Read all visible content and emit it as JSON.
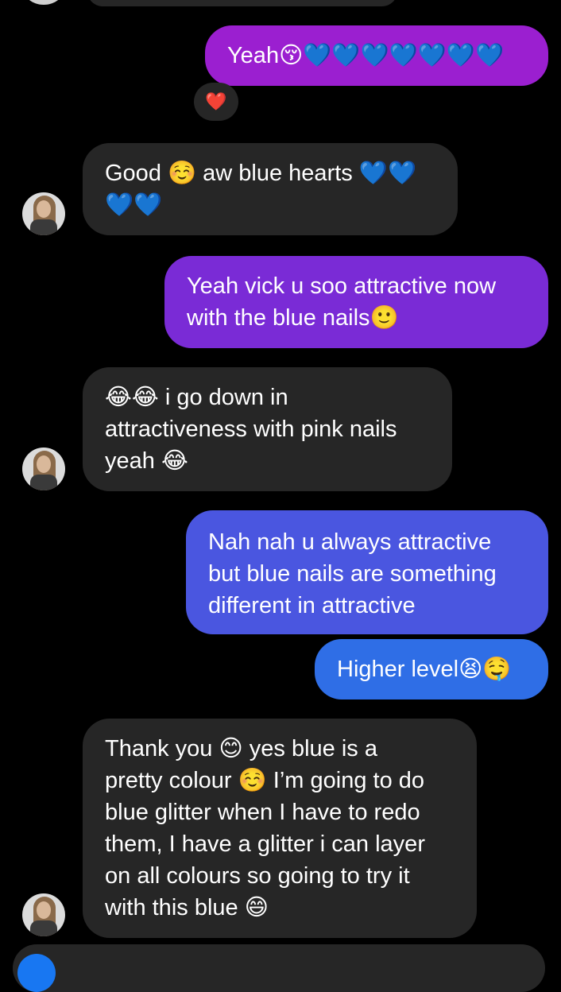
{
  "colors": {
    "background": "#000000",
    "incoming_bubble": "#262626",
    "outgoing_purple": "#9b1fd0",
    "outgoing_violet": "#7a2bd6",
    "outgoing_blue_violet": "#4a56e0",
    "outgoing_blue": "#2f6ee6",
    "reaction_heart": "#e0245e"
  },
  "messages": [
    {
      "direction": "out",
      "text": "Yeah😚💙💙💙💙💙💙💙"
    },
    {
      "direction": "reaction",
      "text": "❤️"
    },
    {
      "direction": "in",
      "text": "Good ☺️ aw blue hearts 💙💙\n💙💙"
    },
    {
      "direction": "out",
      "text": "Yeah vick u soo attractive now\nwith the blue nails🙂"
    },
    {
      "direction": "in",
      "text": "😂😂 i go down in\nattractiveness with pink nails\nyeah 😂"
    },
    {
      "direction": "out",
      "text": "Nah nah u always attractive\nbut blue nails are something\ndifferent in attractive"
    },
    {
      "direction": "out",
      "text": "Higher level😫🤤"
    },
    {
      "direction": "in",
      "text": "Thank you 😊 yes blue is a\npretty colour ☺️ I’m going to do\nblue glitter when I have to redo\nthem, I have a glitter i can layer\non all colours so going to try it\nwith this blue 😄"
    }
  ],
  "icons": {
    "avatar": "contact-avatar-icon",
    "reaction": "heart-reaction-icon"
  }
}
